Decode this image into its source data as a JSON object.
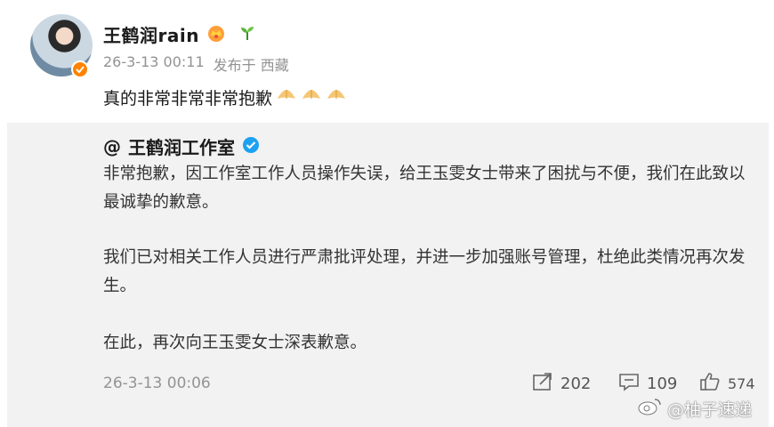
{
  "author": {
    "name": "王鹤润rain",
    "crown_icon": "crown-icon",
    "sprout_icon": "sprout-icon"
  },
  "meta": {
    "time": "26-3-13 00:11",
    "location": "发布于 西藏"
  },
  "post": {
    "text": "真的非常非常非常抱歉",
    "emoji": "clap-emoji",
    "emoji_count": 3
  },
  "quoted": {
    "at": "@",
    "name": "王鹤润工作室",
    "para1": "非常抱歉，因工作室工作人员操作失误，给王玉雯女士带来了困扰与不便，我们在此致以最诚挚的歉意。",
    "para2": "我们已对相关工作人员进行严肃批评处理，并进一步加强账号管理，杜绝此类情况再次发生。",
    "para3": "在此，再次向王玉雯女士深表歉意。",
    "time": "26-3-13 00:06",
    "reposts": "202",
    "comments": "109",
    "likes": "574"
  },
  "watermark": {
    "text": "@柚子速递"
  },
  "colors": {
    "accent_orange": "#ff8200",
    "verified_blue": "#1da1f2",
    "meta_gray": "#939393",
    "repost_bg": "#f2f2f2"
  }
}
